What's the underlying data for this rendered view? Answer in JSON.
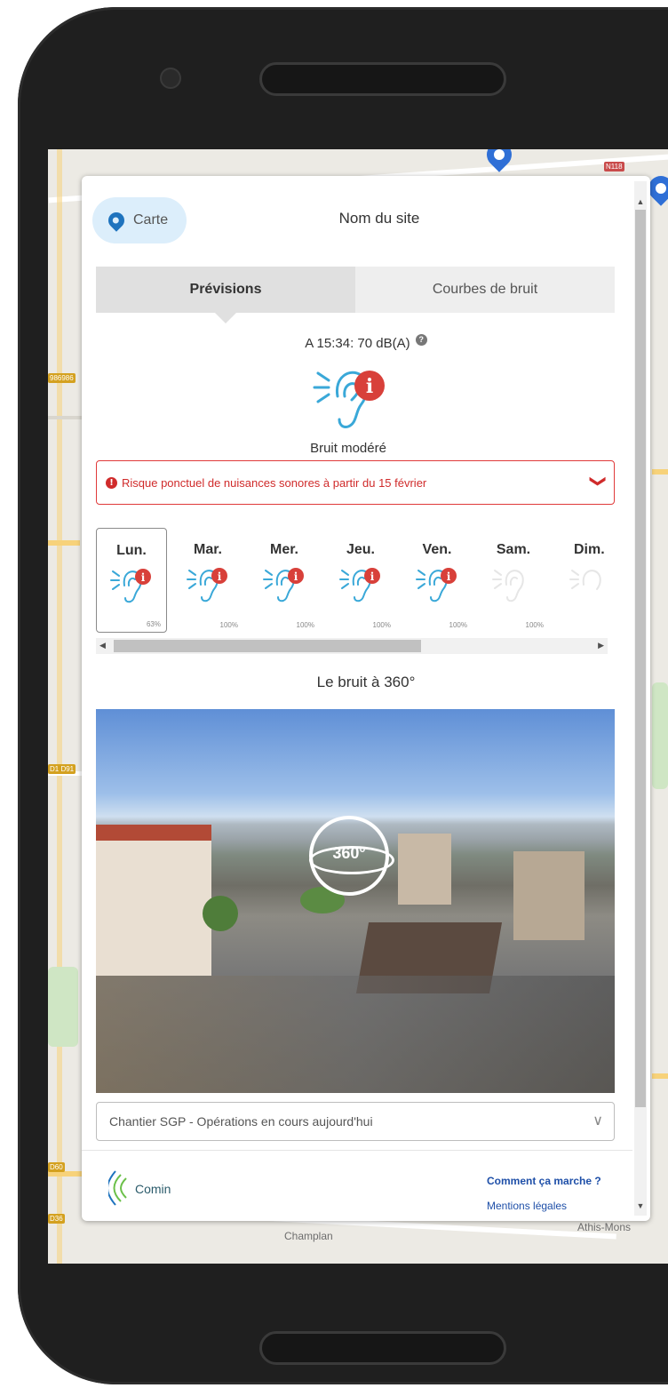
{
  "header": {
    "back_label": "Carte",
    "site_name": "Nom du site"
  },
  "tabs": [
    {
      "label": "Prévisions",
      "active": true
    },
    {
      "label": "Courbes de bruit",
      "active": false
    }
  ],
  "current": {
    "reading": "A 15:34: 70 dB(A)",
    "help_glyph": "?",
    "level_label": "Bruit modéré"
  },
  "alert": {
    "text": "Risque ponctuel de nuisances sonores à partir du 15 février",
    "icon_glyph": "!",
    "chevron": "❯"
  },
  "days": [
    {
      "name": "Lun.",
      "pct": "63%",
      "selected": true,
      "active": true
    },
    {
      "name": "Mar.",
      "pct": "100%",
      "selected": false,
      "active": true
    },
    {
      "name": "Mer.",
      "pct": "100%",
      "selected": false,
      "active": true
    },
    {
      "name": "Jeu.",
      "pct": "100%",
      "selected": false,
      "active": true
    },
    {
      "name": "Ven.",
      "pct": "100%",
      "selected": false,
      "active": true
    },
    {
      "name": "Sam.",
      "pct": "100%",
      "selected": false,
      "active": false
    },
    {
      "name": "Dim.",
      "pct": "",
      "selected": false,
      "active": false
    }
  ],
  "panorama": {
    "title": "Le bruit à 360°",
    "badge": "360°"
  },
  "operations": {
    "selected": "Chantier SGP - Opérations en cours aujourd'hui"
  },
  "footer": {
    "logo_text": "Comin",
    "link_how": "Comment ça marche ?",
    "link_legal": "Mentions légales"
  },
  "map": {
    "labels": [
      "Champlan",
      "Athis-Mons"
    ]
  },
  "colors": {
    "accent_blue": "#1e73be",
    "alert_red": "#d02b2b",
    "ear_blue": "#3aa8d8",
    "ear_red": "#d8403a"
  },
  "icons": {
    "pin": "map-pin-icon",
    "ear": "ear-icon",
    "help": "help-icon",
    "warning": "warning-icon",
    "chevron": "chevron-down-icon",
    "logo": "comin-logo-icon"
  }
}
